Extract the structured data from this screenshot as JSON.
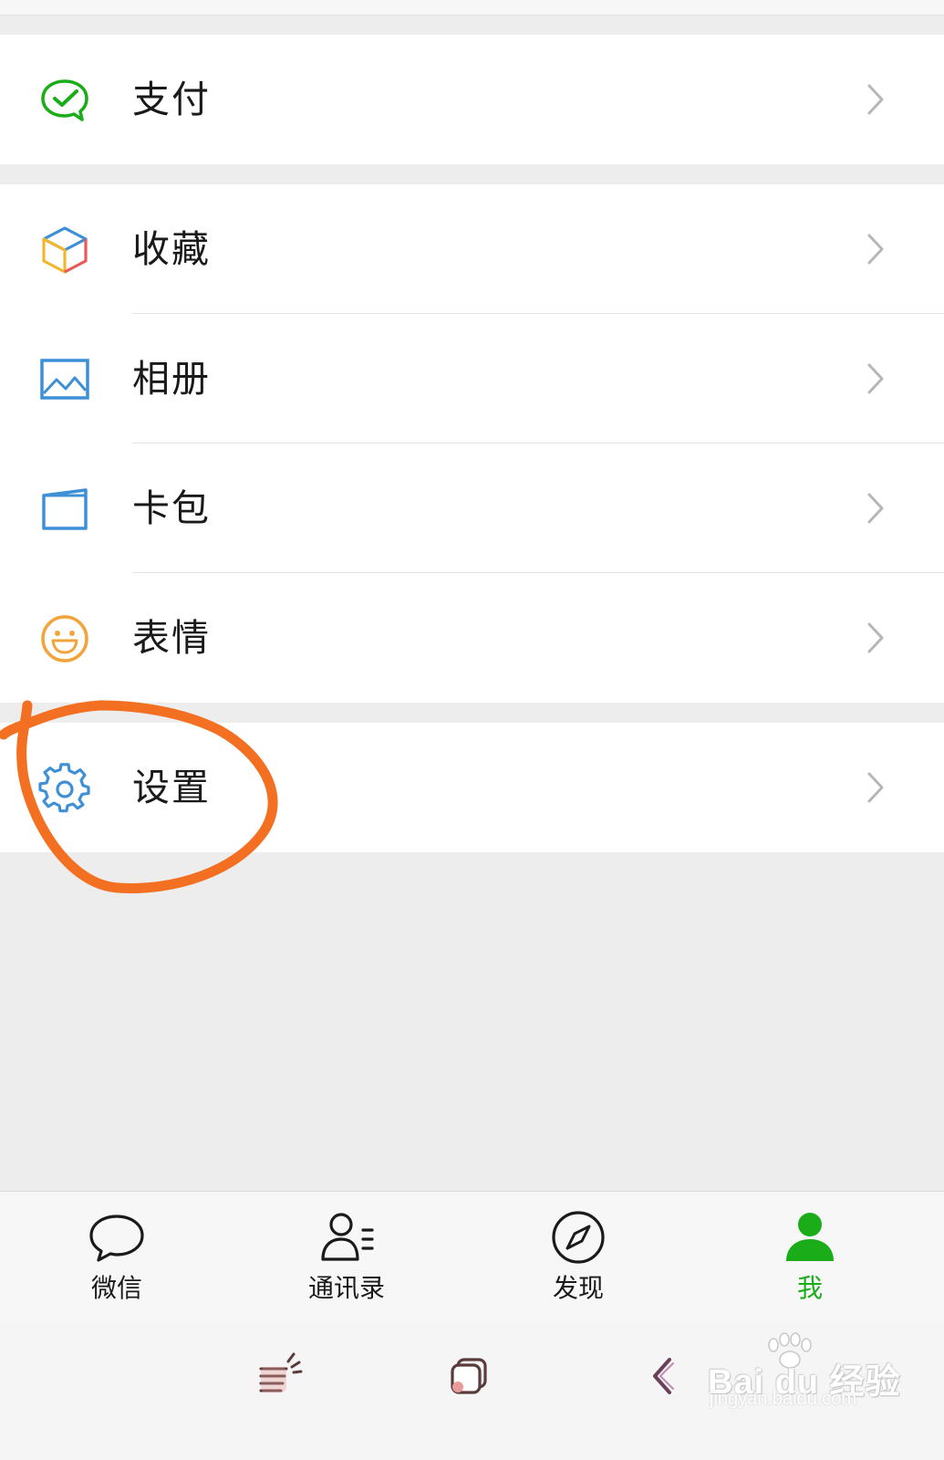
{
  "menu_groups": [
    {
      "items": [
        {
          "label": "支付",
          "icon": "wechat-pay-icon"
        }
      ]
    },
    {
      "items": [
        {
          "label": "收藏",
          "icon": "favorites-cube-icon"
        },
        {
          "label": "相册",
          "icon": "album-picture-icon"
        },
        {
          "label": "卡包",
          "icon": "card-wallet-icon"
        },
        {
          "label": "表情",
          "icon": "smiley-face-icon"
        }
      ]
    },
    {
      "items": [
        {
          "label": "设置",
          "icon": "gear-icon"
        }
      ]
    }
  ],
  "tabs": [
    {
      "label": "微信",
      "icon": "chat-bubble-icon",
      "active": false
    },
    {
      "label": "通讯录",
      "icon": "contacts-icon",
      "active": false
    },
    {
      "label": "发现",
      "icon": "compass-icon",
      "active": false
    },
    {
      "label": "我",
      "icon": "person-icon",
      "active": true
    }
  ],
  "system_nav": [
    {
      "icon": "menu-icon"
    },
    {
      "icon": "home-icon"
    },
    {
      "icon": "back-icon"
    }
  ],
  "watermark": {
    "brand": "Bai du 经验",
    "url": "jingyan.baidu.com"
  },
  "colors": {
    "wechat_green": "#1aad19",
    "annotation_orange": "#f36f21",
    "icon_blue": "#3d8fd6",
    "background": "#ededed"
  }
}
